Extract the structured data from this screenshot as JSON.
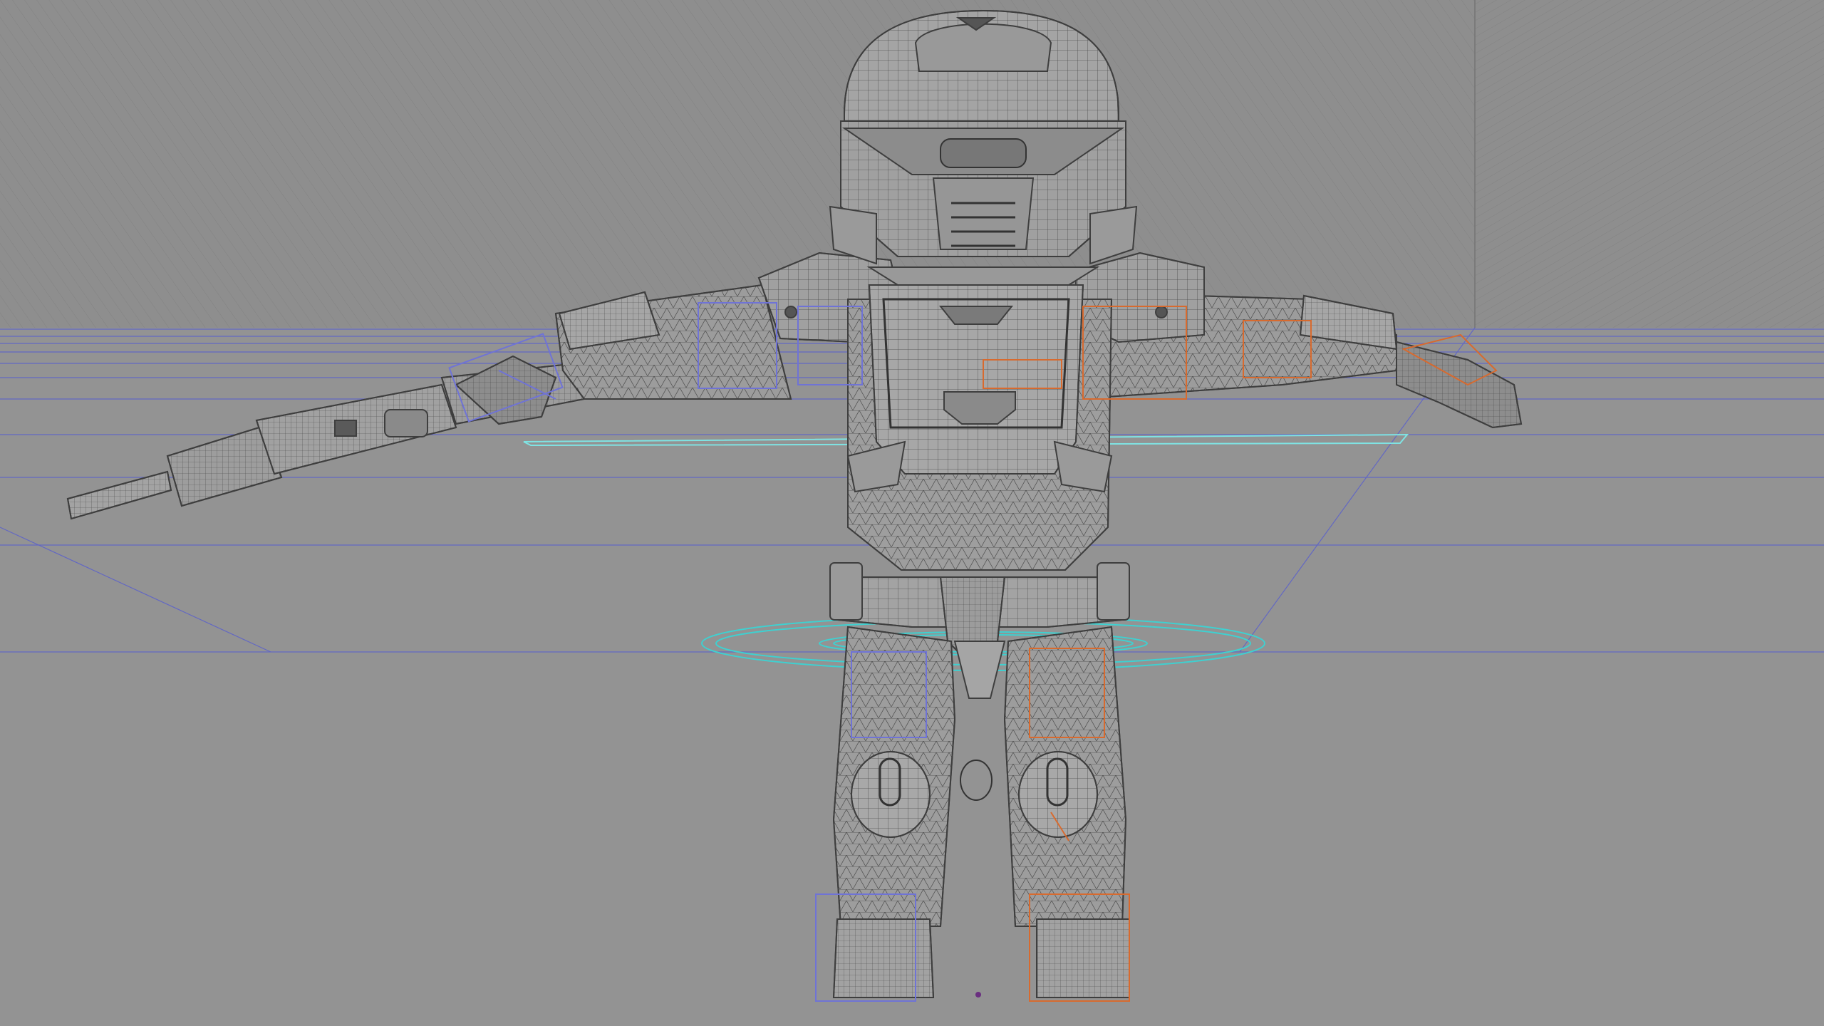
{
  "viewport": {
    "name": "3d-viewport",
    "shading_mode": "wireframe-on-shaded",
    "subject": "armored-character-t-pose",
    "colors": {
      "background": "#919191",
      "back_wall": "#8d8d8d",
      "wall_hatch": "#7f7f7f",
      "mesh_fill": "#9b9b9b",
      "mesh_line": "#3e3e3e",
      "mesh_dense": "#5a5a5a",
      "bone_left": "#6f73d6",
      "bone_right": "#d86a2e",
      "ground_circle": "#3fd0d0",
      "horizon_lines": "#4f55c9",
      "selected_plane": "#7fe3e3"
    }
  }
}
